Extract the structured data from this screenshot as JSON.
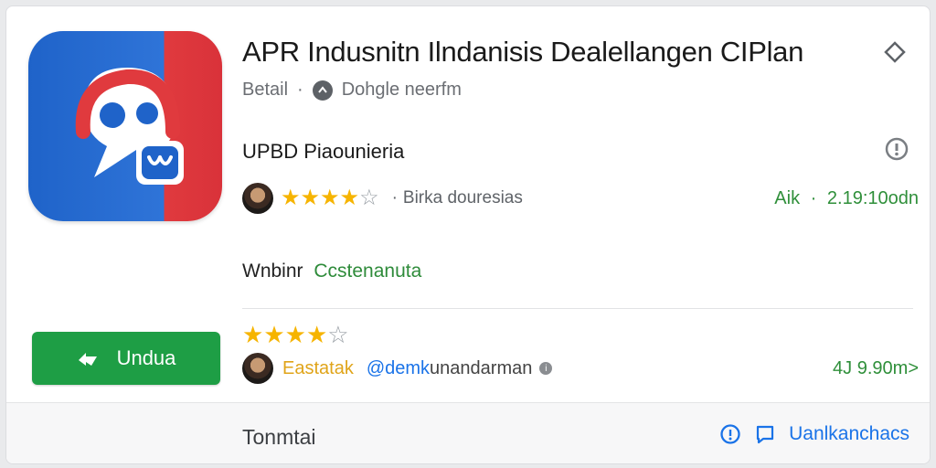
{
  "app": {
    "title": "APR Indusnitn Ilndanisis Dealellangen CIPlan",
    "category": "Betail",
    "separator": "·",
    "developer": "Dohgle neerfm",
    "colors": {
      "icon_blue": "#1f63c9",
      "icon_red": "#e03a3e",
      "accent_green": "#1e9e45",
      "star": "#f6b400"
    }
  },
  "section": {
    "title": "UPBD Piaounieria"
  },
  "rating_summary": {
    "rating_stars": 4,
    "max_stars": 5,
    "separator": "·",
    "label": "Birka douresias",
    "right_label": "Aik",
    "right_separator": "·",
    "right_value": "2.19:10odn"
  },
  "website": {
    "label": "Wnbinr",
    "value": "Ccstenanuta"
  },
  "install_button": {
    "label": "Undua",
    "icon": "arrow-icon"
  },
  "review": {
    "rating_stars": 4,
    "max_stars": 5,
    "reviewer": "Eastatak",
    "handle": "@demk",
    "handle_rest": "unandarman",
    "right_value": "4J 9.90m>"
  },
  "footer": {
    "text": "Tonmtai",
    "action_label": "Uanlkanchacs",
    "icons": [
      "info-icon",
      "comment-icon"
    ]
  }
}
